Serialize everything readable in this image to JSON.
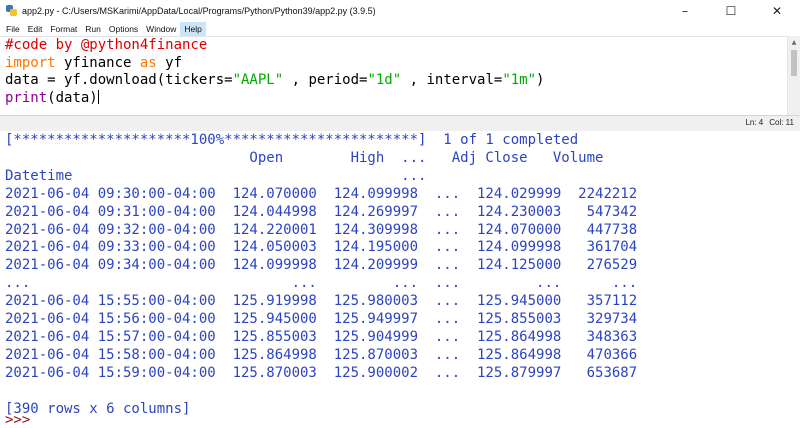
{
  "window": {
    "title": "app2.py - C:/Users/MSKarimi/AppData/Local/Programs/Python/Python39/app2.py (3.9.5)",
    "controls": {
      "minimize": "–",
      "maximize": "☐",
      "close": "✕"
    }
  },
  "menu": [
    "File",
    "Edit",
    "Format",
    "Run",
    "Options",
    "Window",
    "Help"
  ],
  "menu_active": "Help",
  "editor": {
    "line1": "#code by @python4finance",
    "line2_kw": "import",
    "line2_rest": " yfinance ",
    "line2_kw2": "as",
    "line2_end": " yf",
    "line3_a": "data = yf.download(tickers=",
    "line3_s1": "\"AAPL\"",
    "line3_b": " , period=",
    "line3_s2": "\"1d\"",
    "line3_c": " , interval=",
    "line3_s3": "\"1m\"",
    "line3_d": ")",
    "line4_fn": "print",
    "line4_rest": "(data)"
  },
  "status": {
    "line": "Ln: 4",
    "col": "Col: 11"
  },
  "shell": {
    "progress_line": "[*********************100%***********************]  1 of 1 completed",
    "header_line": "                             Open        High  ...   Adj Close   Volume",
    "index_line": "Datetime                                       ...",
    "rows": [
      "2021-06-04 09:30:00-04:00  124.070000  124.099998  ...  124.029999  2242212",
      "2021-06-04 09:31:00-04:00  124.044998  124.269997  ...  124.230003   547342",
      "2021-06-04 09:32:00-04:00  124.220001  124.309998  ...  124.070000   447738",
      "2021-06-04 09:33:00-04:00  124.050003  124.195000  ...  124.099998   361704",
      "2021-06-04 09:34:00-04:00  124.099998  124.209999  ...  124.125000   276529",
      "...                               ...         ...  ...         ...      ...",
      "2021-06-04 15:55:00-04:00  125.919998  125.980003  ...  125.945000   357112",
      "2021-06-04 15:56:00-04:00  125.945000  125.949997  ...  125.855003   329734",
      "2021-06-04 15:57:00-04:00  125.855003  125.904999  ...  125.864998   348363",
      "2021-06-04 15:58:00-04:00  125.864998  125.870003  ...  125.864998   470366",
      "2021-06-04 15:59:00-04:00  125.870003  125.900002  ...  125.879997   653687"
    ],
    "summary": "[390 rows x 6 columns]",
    "prompt": ">>>"
  }
}
